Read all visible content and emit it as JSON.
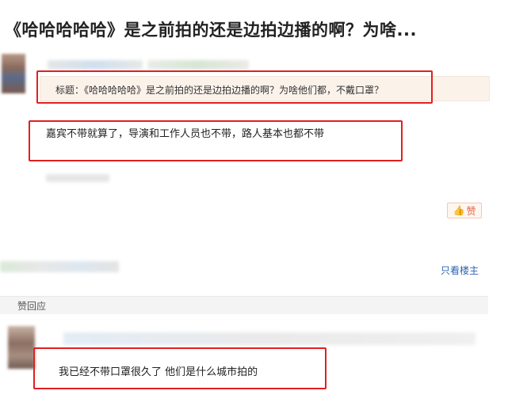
{
  "post": {
    "title": "《哈哈哈哈哈》是之前拍的还是边拍边播的啊？为啥...",
    "subject_line": "标题：《哈哈哈哈哈》是之前拍的还是边拍边播的啊？为啥他们都，不戴口罩？",
    "body": "嘉宾不带就算了，导演和工作人员也不带，路人基本也都不带",
    "like_label": "赞",
    "only_owner_label": "只看楼主"
  },
  "reply_section": {
    "header_label": "赞回应",
    "reply_text": "我已经不带口罩很久了 他们是什么城市拍的"
  },
  "colors": {
    "highlight_border": "#e02020",
    "link": "#2d64b3",
    "like_accent": "#e0684a"
  }
}
